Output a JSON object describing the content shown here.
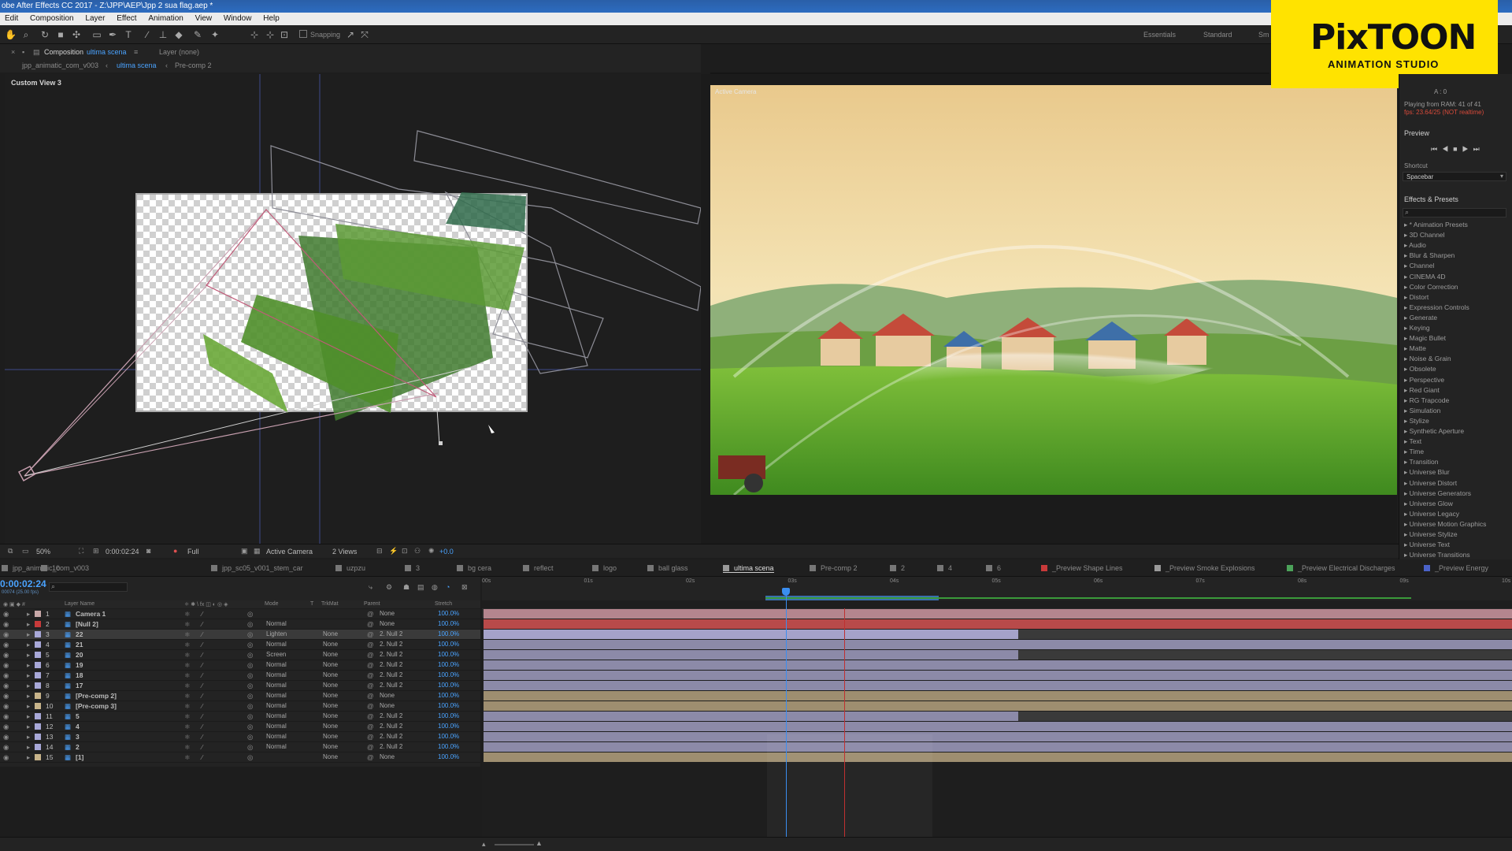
{
  "window": {
    "title": "obe After Effects CC 2017 - Z:\\JPP\\AEP\\Jpp 2 sua flag.aep *"
  },
  "menu": [
    "Edit",
    "Composition",
    "Layer",
    "Effect",
    "Animation",
    "View",
    "Window",
    "Help"
  ],
  "toolbar": {
    "snapping_label": "Snapping",
    "workspaces": [
      "Essentials",
      "Standard",
      "Sm"
    ]
  },
  "panels": {
    "composition_prefix": "Composition",
    "composition_name": "ultima scena",
    "layer_label": "Layer (none)",
    "breadcrumbs": [
      "jpp_animatic_com_v003",
      "ultima scena",
      "Pre-comp 2"
    ],
    "left_view_label": "Custom View 3",
    "right_view_label": "Active Camera"
  },
  "logo": {
    "brand": "PixTOON",
    "tagline": "ANIMATION STUDIO"
  },
  "right_panel": {
    "info_line1": "A : 0",
    "info_line2": "Playing from RAM: 41 of 41",
    "info_line3": "fps: 23.64/25 (NOT realtime)",
    "preview_title": "Preview",
    "shortcut_label": "Shortcut",
    "shortcut_value": "Spacebar",
    "effects_title": "Effects & Presets",
    "effects": [
      "* Animation Presets",
      "3D Channel",
      "Audio",
      "Blur & Sharpen",
      "Channel",
      "CINEMA 4D",
      "Color Correction",
      "Distort",
      "Expression Controls",
      "Generate",
      "Keying",
      "Magic Bullet",
      "Matte",
      "Noise & Grain",
      "Obsolete",
      "Perspective",
      "Red Giant",
      "RG Trapcode",
      "Simulation",
      "Stylize",
      "Synthetic Aperture",
      "Text",
      "Time",
      "Transition",
      "Universe Blur",
      "Universe Distort",
      "Universe Generators",
      "Universe Glow",
      "Universe Legacy",
      "Universe Motion Graphics",
      "Universe Stylize",
      "Universe Text",
      "Universe Transitions"
    ]
  },
  "viewer_footer": {
    "zoom": "50%",
    "timecode": "0:00:02:24",
    "resolution": "Full",
    "camera": "Active Camera",
    "views": "2 Views",
    "exposure": "+0.0"
  },
  "timeline_tabs": [
    {
      "label": "jpp_animatic_com_v003",
      "color": "#777777"
    },
    {
      "label": "10",
      "color": "#777777"
    },
    {
      "label": "jpp_sc05_v001_stem_car",
      "color": "#777777"
    },
    {
      "label": "uzpzu",
      "color": "#777777"
    },
    {
      "label": "3",
      "color": "#777777"
    },
    {
      "label": "bg cera",
      "color": "#777777"
    },
    {
      "label": "reflect",
      "color": "#777777"
    },
    {
      "label": "logo",
      "color": "#777777"
    },
    {
      "label": "ball glass",
      "color": "#777777"
    },
    {
      "label": "ultima scena",
      "color": "#9a9a9a",
      "active": true
    },
    {
      "label": "Pre-comp 2",
      "color": "#777777"
    },
    {
      "label": "2",
      "color": "#777777"
    },
    {
      "label": "4",
      "color": "#777777"
    },
    {
      "label": "6",
      "color": "#777777"
    },
    {
      "label": "_Preview Shape Lines",
      "color": "#c83a3a"
    },
    {
      "label": "_Preview Smoke Explosions",
      "color": "#9a9a9a"
    },
    {
      "label": "_Preview Electrical Discharges",
      "color": "#4ca35a"
    },
    {
      "label": "_Preview Energy",
      "color": "#4a62c8"
    }
  ],
  "timeline": {
    "current_time": "0:00:02:24",
    "fps_note": "00074 (25.00 fps)",
    "headers": [
      "Layer Name",
      "Mode",
      "T",
      "TrkMat",
      "Parent",
      "Stretch"
    ],
    "ruler": [
      "00s",
      "01s",
      "02s",
      "03s",
      "04s",
      "05s",
      "06s",
      "07s",
      "08s",
      "09s",
      "10s"
    ],
    "layers": [
      {
        "num": "1",
        "name": "Camera 1",
        "mode": "",
        "trkmat": "",
        "parent": "None",
        "stretch": "100.0%",
        "color": "#c8a8a8",
        "bar": "#b4858e",
        "bar_end": 1.0
      },
      {
        "num": "2",
        "name": "[Null 2]",
        "mode": "Normal",
        "trkmat": "",
        "parent": "None",
        "stretch": "100.0%",
        "color": "#c83a3a",
        "bar": "#b84a4a",
        "bar_end": 1.0
      },
      {
        "num": "3",
        "name": "22",
        "mode": "Lighten",
        "trkmat": "None",
        "parent": "2. Null 2",
        "stretch": "100.0%",
        "color": "#a8a8d8",
        "bar": "#a5a2c9",
        "bar_end": 0.52,
        "selected": true
      },
      {
        "num": "4",
        "name": "21",
        "mode": "Normal",
        "trkmat": "None",
        "parent": "2. Null 2",
        "stretch": "100.0%",
        "color": "#a8a8d8",
        "bar": "#8c8aa8",
        "bar_end": 1.0
      },
      {
        "num": "5",
        "name": "20",
        "mode": "Screen",
        "trkmat": "None",
        "parent": "2. Null 2",
        "stretch": "100.0%",
        "color": "#a8a8d8",
        "bar": "#8c8aa8",
        "bar_end": 0.52
      },
      {
        "num": "6",
        "name": "19",
        "mode": "Normal",
        "trkmat": "None",
        "parent": "2. Null 2",
        "stretch": "100.0%",
        "color": "#a8a8d8",
        "bar": "#8c8aa8",
        "bar_end": 1.0
      },
      {
        "num": "7",
        "name": "18",
        "mode": "Normal",
        "trkmat": "None",
        "parent": "2. Null 2",
        "stretch": "100.0%",
        "color": "#a8a8d8",
        "bar": "#8c8aa8",
        "bar_end": 1.0
      },
      {
        "num": "8",
        "name": "17",
        "mode": "Normal",
        "trkmat": "None",
        "parent": "2. Null 2",
        "stretch": "100.0%",
        "color": "#a8a8d8",
        "bar": "#8c8aa8",
        "bar_end": 1.0
      },
      {
        "num": "9",
        "name": "[Pre-comp 2]",
        "mode": "Normal",
        "trkmat": "None",
        "parent": "None",
        "stretch": "100.0%",
        "color": "#c8b48a",
        "bar": "#9e8e70",
        "bar_end": 1.0
      },
      {
        "num": "10",
        "name": "[Pre-comp 3]",
        "mode": "Normal",
        "trkmat": "None",
        "parent": "None",
        "stretch": "100.0%",
        "color": "#c8b48a",
        "bar": "#9e8e70",
        "bar_end": 1.0
      },
      {
        "num": "11",
        "name": "5",
        "mode": "Normal",
        "trkmat": "None",
        "parent": "2. Null 2",
        "stretch": "100.0%",
        "color": "#a8a8d8",
        "bar": "#8c8aa8",
        "bar_end": 0.52
      },
      {
        "num": "12",
        "name": "4",
        "mode": "Normal",
        "trkmat": "None",
        "parent": "2. Null 2",
        "stretch": "100.0%",
        "color": "#a8a8d8",
        "bar": "#8c8aa8",
        "bar_end": 1.0
      },
      {
        "num": "13",
        "name": "3",
        "mode": "Normal",
        "trkmat": "None",
        "parent": "2. Null 2",
        "stretch": "100.0%",
        "color": "#a8a8d8",
        "bar": "#8c8aa8",
        "bar_end": 1.0
      },
      {
        "num": "14",
        "name": "2",
        "mode": "Normal",
        "trkmat": "None",
        "parent": "2. Null 2",
        "stretch": "100.0%",
        "color": "#a8a8d8",
        "bar": "#8c8aa8",
        "bar_end": 1.0
      },
      {
        "num": "15",
        "name": "[1]",
        "mode": "",
        "trkmat": "None",
        "parent": "None",
        "stretch": "100.0%",
        "color": "#c8b48a",
        "bar": "#9e8e70",
        "bar_end": 1.0
      }
    ]
  }
}
